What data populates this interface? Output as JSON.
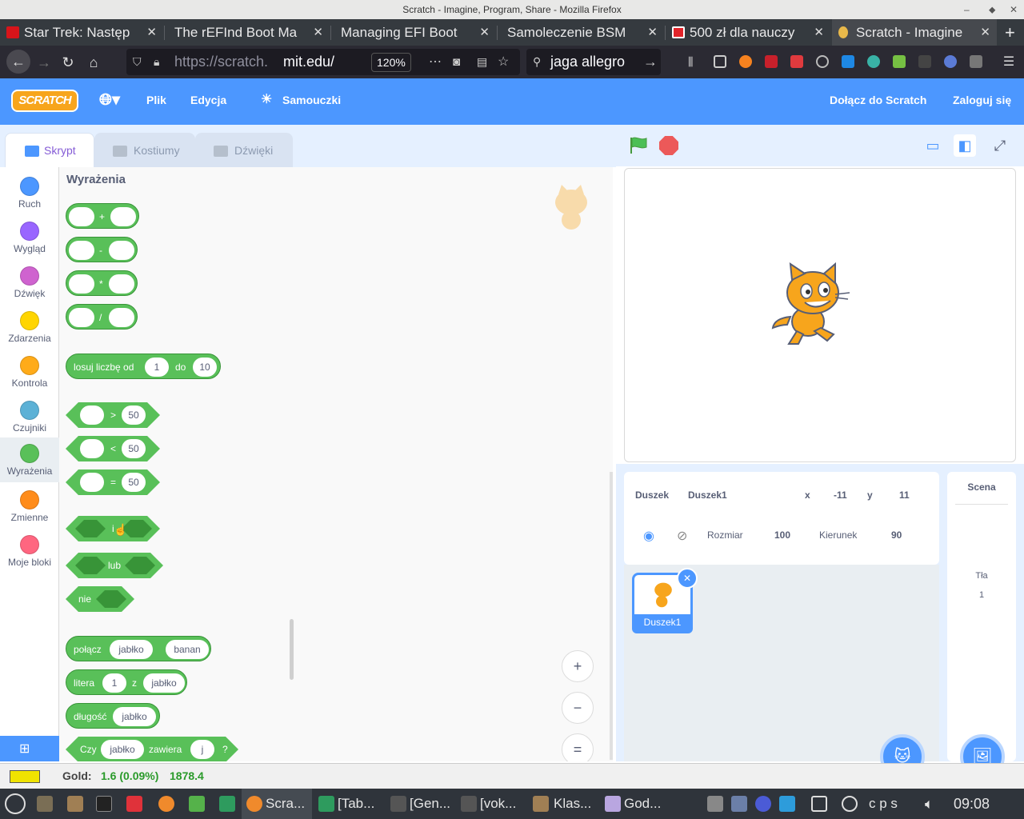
{
  "window": {
    "title": "Scratch - Imagine, Program, Share - Mozilla Firefox"
  },
  "tabs": [
    {
      "label": "Star Trek: Następ",
      "icon": "cda-icon",
      "color": "#d7141a"
    },
    {
      "label": "The rEFInd Boot Ma",
      "icon": "",
      "color": ""
    },
    {
      "label": "Managing EFI Boot",
      "icon": "",
      "color": ""
    },
    {
      "label": "Samoleczenie BSM",
      "icon": "",
      "color": ""
    },
    {
      "label": "500 zł dla nauczy",
      "icon": "news-icon",
      "color": "#e2242a"
    },
    {
      "label": "Scratch - Imagine",
      "icon": "scratch-icon",
      "color": "#e8b84a"
    }
  ],
  "navbar": {
    "url_dim": "https://scratch.",
    "url_main": "mit.edu/",
    "zoom": "120%",
    "search": "jaga allegro"
  },
  "scratch_menu": {
    "logo": "SCRATCH",
    "file": "Plik",
    "edit": "Edycja",
    "tutorials": "Samouczki",
    "join": "Dołącz do Scratch",
    "signin": "Zaloguj się"
  },
  "editor_tabs": {
    "code": "Skrypt",
    "costumes": "Kostiumy",
    "sounds": "Dźwięki"
  },
  "categories": [
    {
      "label": "Ruch",
      "color": "#4c97ff"
    },
    {
      "label": "Wygląd",
      "color": "#9966ff"
    },
    {
      "label": "Dźwięk",
      "color": "#cf63cf"
    },
    {
      "label": "Zdarzenia",
      "color": "#ffd500"
    },
    {
      "label": "Kontrola",
      "color": "#ffab19"
    },
    {
      "label": "Czujniki",
      "color": "#5cb1d6"
    },
    {
      "label": "Wyrażenia",
      "color": "#59c059"
    },
    {
      "label": "Zmienne",
      "color": "#ff8c1a"
    },
    {
      "label": "Moje bloki",
      "color": "#ff6680"
    }
  ],
  "palette": {
    "heading": "Wyrażenia",
    "ops": [
      "+",
      "-",
      "*",
      "/"
    ],
    "random": {
      "label1": "losuj liczbę od",
      "v1": "1",
      "label2": "do",
      "v2": "10"
    },
    "compare": [
      {
        "op": ">",
        "v": "50"
      },
      {
        "op": "<",
        "v": "50"
      },
      {
        "op": "=",
        "v": "50"
      }
    ],
    "and_label": "i",
    "or_label": "lub",
    "not_label": "nie",
    "join": {
      "label": "połącz",
      "a": "jabłko",
      "b": "banan"
    },
    "letter": {
      "label1": "litera",
      "n": "1",
      "label2": "z",
      "s": "jabłko"
    },
    "length": {
      "label": "długość",
      "s": "jabłko"
    },
    "contains": {
      "label1": "Czy",
      "s": "jabłko",
      "label2": "zawiera",
      "c": "j",
      "q": "?"
    }
  },
  "zoom": {
    "in": "+",
    "out": "−",
    "reset": "="
  },
  "sprite_info": {
    "sprite_label": "Duszek",
    "sprite_name": "Duszek1",
    "x_label": "x",
    "x": "-11",
    "y_label": "y",
    "y": "11",
    "size_label": "Rozmiar",
    "size": "100",
    "direction_label": "Kierunek",
    "direction": "90"
  },
  "sprite_thumb": "Duszek1",
  "stage_panel": {
    "title": "Scena",
    "backdrops_label": "Tła",
    "backdrops_count": "1"
  },
  "statusbar": {
    "label": "Gold:",
    "value": "1.6 (0.09%)",
    "extra": "1878.4",
    "swatch": "#f0e300"
  },
  "taskbar": {
    "items": [
      "Scra...",
      "[Tab...",
      "[Gen...",
      "[vok...",
      "Klas...",
      "God..."
    ],
    "tray_text": "c p s",
    "clock": "09:08"
  }
}
